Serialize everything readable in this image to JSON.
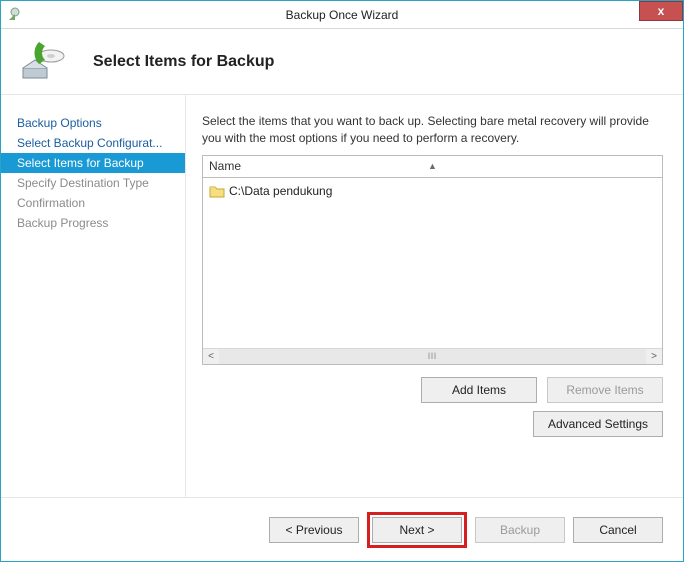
{
  "window": {
    "title": "Backup Once Wizard",
    "close_label": "x"
  },
  "header": {
    "title": "Select Items for Backup"
  },
  "sidebar": {
    "items": [
      {
        "label": "Backup Options",
        "state": "link"
      },
      {
        "label": "Select Backup Configurat...",
        "state": "link"
      },
      {
        "label": "Select Items for Backup",
        "state": "active"
      },
      {
        "label": "Specify Destination Type",
        "state": "disabled"
      },
      {
        "label": "Confirmation",
        "state": "disabled"
      },
      {
        "label": "Backup Progress",
        "state": "disabled"
      }
    ]
  },
  "main": {
    "description": "Select the items that you want to back up. Selecting bare metal recovery will provide you with the most options if you need to perform a recovery.",
    "column_header": "Name",
    "rows": [
      {
        "label": "C:\\Data pendukung"
      }
    ],
    "add_items_label": "Add Items",
    "remove_items_label": "Remove Items",
    "advanced_label": "Advanced Settings"
  },
  "footer": {
    "previous": "< Previous",
    "next": "Next >",
    "backup": "Backup",
    "cancel": "Cancel"
  }
}
